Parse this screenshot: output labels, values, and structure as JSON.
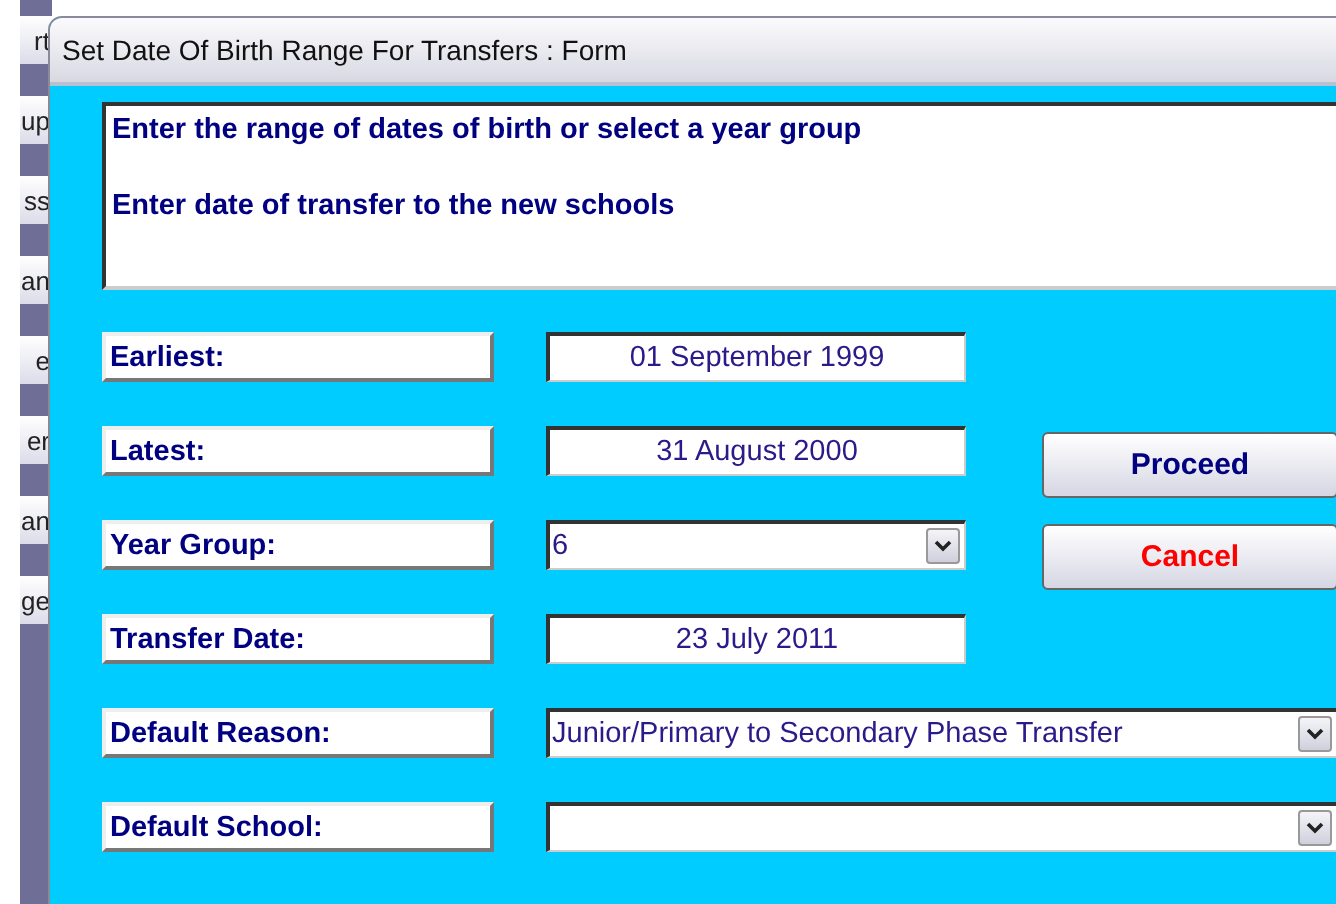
{
  "background_buttons": [
    "rt",
    "up",
    "ss",
    "an",
    "e",
    "er",
    "an",
    "ge"
  ],
  "window": {
    "title": "Set Date Of Birth Range For Transfers : Form"
  },
  "instructions": [
    "Enter the range of dates of birth or select a year group",
    "Enter date of transfer to the new schools"
  ],
  "fields": [
    {
      "label": "Earliest:",
      "kind": "date",
      "value": "01 September 1999"
    },
    {
      "label": "Latest:",
      "kind": "date",
      "value": "31 August 2000"
    },
    {
      "label": "Year Group:",
      "kind": "select",
      "value": "6"
    },
    {
      "label": "Transfer Date:",
      "kind": "date",
      "value": "23 July 2011"
    },
    {
      "label": "Default Reason:",
      "kind": "wide-select",
      "value": "Junior/Primary to Secondary Phase Transfer"
    },
    {
      "label": "Default School:",
      "kind": "wide-select"
    }
  ],
  "buttons": [
    {
      "label": "Proceed",
      "kind": "proceed"
    },
    {
      "label": "Cancel",
      "kind": "cancel"
    }
  ]
}
